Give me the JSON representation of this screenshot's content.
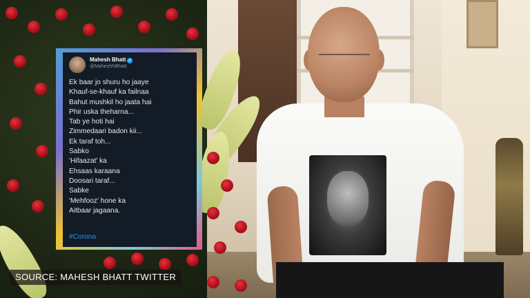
{
  "tweet": {
    "author_name": "Mahesh Bhatt",
    "author_handle": "@MaheshNBhatt",
    "lines": [
      "Ek baar jo shuru ho jaaye",
      "Khauf-se-khauf ka failnaa",
      "Bahut mushkil ho jaata hai",
      "Phir uska theharna...",
      "Tab ye hoti hai",
      "Zimmedaari badon kii...",
      "Ek taraf toh...",
      "Sabko",
      "'Hifaazat' ka",
      "Ehsaas karaana",
      "Doosari taraf...",
      "Sabke",
      "'Mehfooz' hone ka",
      "Aitbaar jagaana."
    ],
    "hashtag": "#Corona",
    "avatar_icon": "profile-photo",
    "verified_icon": "verified-badge-icon",
    "accent_color": "#1d9bf0"
  },
  "caption": {
    "text": "SOURCE: MAHESH BHATT TWITTER"
  }
}
